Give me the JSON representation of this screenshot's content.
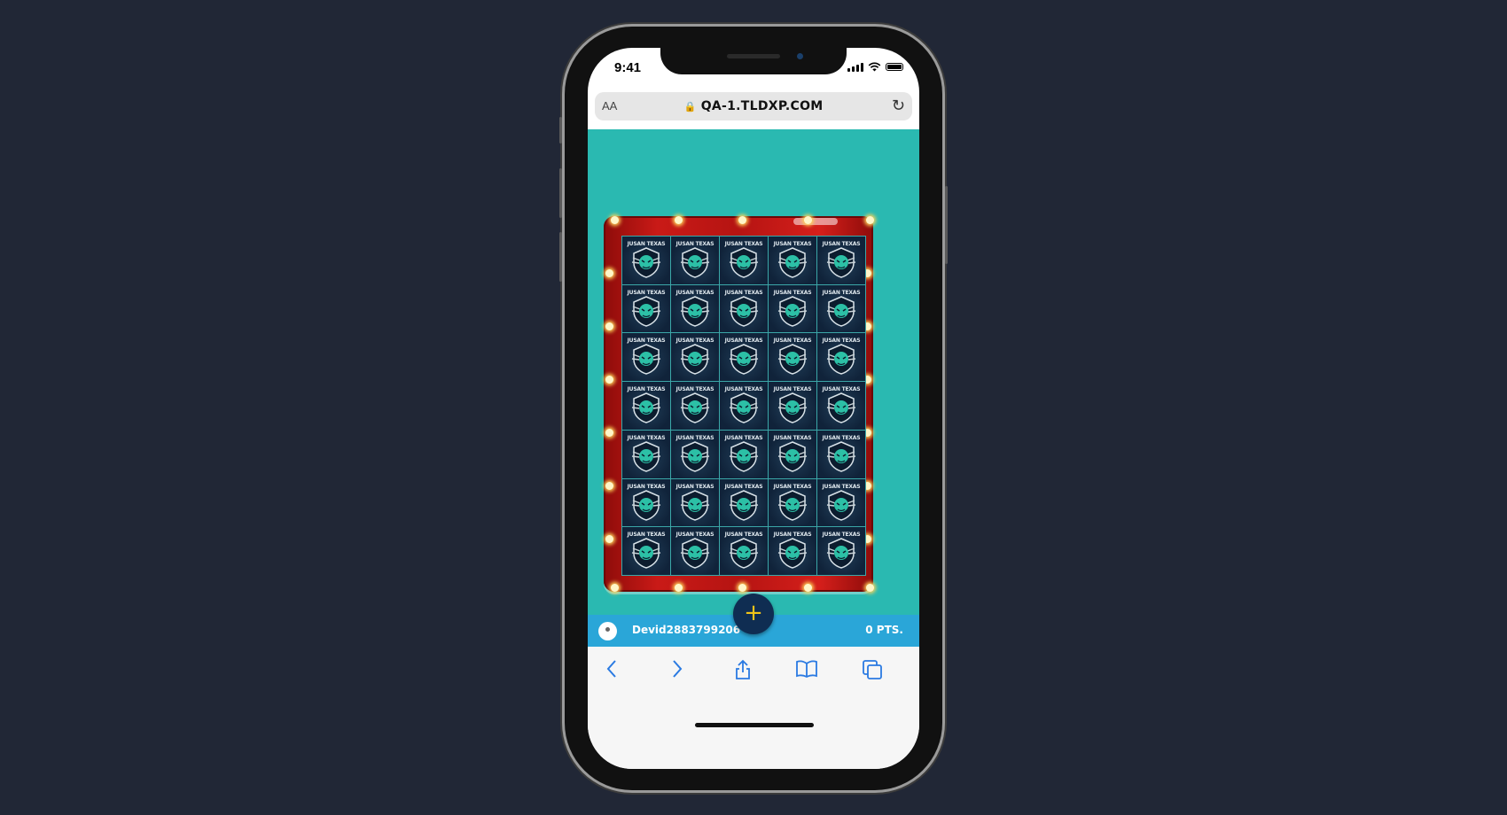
{
  "status_bar": {
    "time": "9:41"
  },
  "url_bar": {
    "text_size_label": "AA",
    "url": "QA-1.TLDXP.COM"
  },
  "game": {
    "rows": 7,
    "columns": 5,
    "tile_title": "JUSAN TEXAS",
    "colors": {
      "background": "#2ab9b1",
      "frame": "#c91a17",
      "tile": "#10233a",
      "logo": "#2cc0a6"
    }
  },
  "user_bar": {
    "username": "Devid2883799206",
    "points": "0 PTS."
  },
  "fab": {
    "label": "+"
  },
  "toolbar": {
    "items": [
      "back-icon",
      "forward-icon",
      "share-icon",
      "bookmarks-icon",
      "tabs-icon"
    ]
  }
}
